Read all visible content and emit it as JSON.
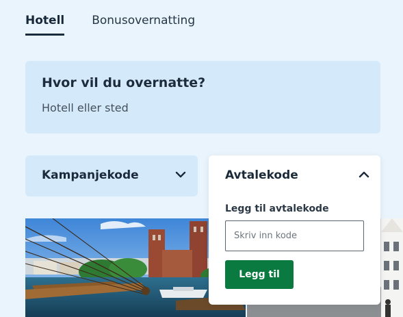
{
  "tabs": [
    {
      "label": "Hotell",
      "active": true
    },
    {
      "label": "Bonusovernatting",
      "active": false
    }
  ],
  "search": {
    "title": "Hvor vil du overnatte?",
    "hint": "Hotell eller sted"
  },
  "campaign_code": {
    "label": "Kampanjekode",
    "expanded": false
  },
  "agreement_code": {
    "label": "Avtalekode",
    "expanded": true,
    "field_label": "Legg til avtalekode",
    "placeholder": "Skriv inn kode",
    "value": "",
    "button_label": "Legg til"
  },
  "icons": {
    "campaign_toggle": "chevron-down-icon",
    "agreement_toggle": "chevron-up-icon"
  },
  "colors": {
    "accent": "#0b7a41",
    "panel": "#d4eafb",
    "background": "#eaf4fc"
  }
}
